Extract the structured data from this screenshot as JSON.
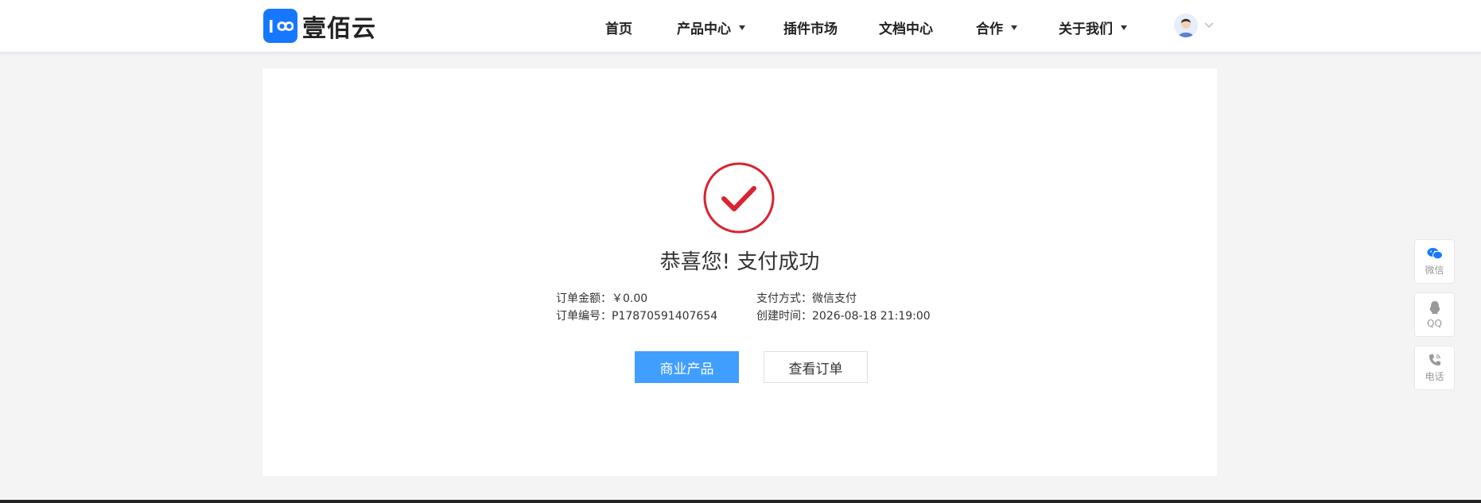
{
  "header": {
    "logo_text": "壹佰云",
    "nav": [
      {
        "label": "首页",
        "dropdown": false
      },
      {
        "label": "产品中心",
        "dropdown": true
      },
      {
        "label": "插件市场",
        "dropdown": false
      },
      {
        "label": "文档中心",
        "dropdown": false
      },
      {
        "label": "合作",
        "dropdown": true
      },
      {
        "label": "关于我们",
        "dropdown": true
      }
    ]
  },
  "result": {
    "title": "恭喜您! 支付成功",
    "amount_label": "订单金额：",
    "amount_value": "￥0.00",
    "order_no_label": "订单编号：",
    "order_no_value": "P17870591407654",
    "pay_method_label": "支付方式：",
    "pay_method_value": "微信支付",
    "created_label": "创建时间：",
    "created_value": "2026-08-18 21:19:00",
    "primary_button": "商业产品",
    "secondary_button": "查看订单"
  },
  "side": {
    "wechat": "微信",
    "qq": "QQ",
    "phone": "电话"
  },
  "colors": {
    "brand": "#1677ff",
    "primary_button": "#409eff",
    "success_icon": "#d9232e"
  }
}
